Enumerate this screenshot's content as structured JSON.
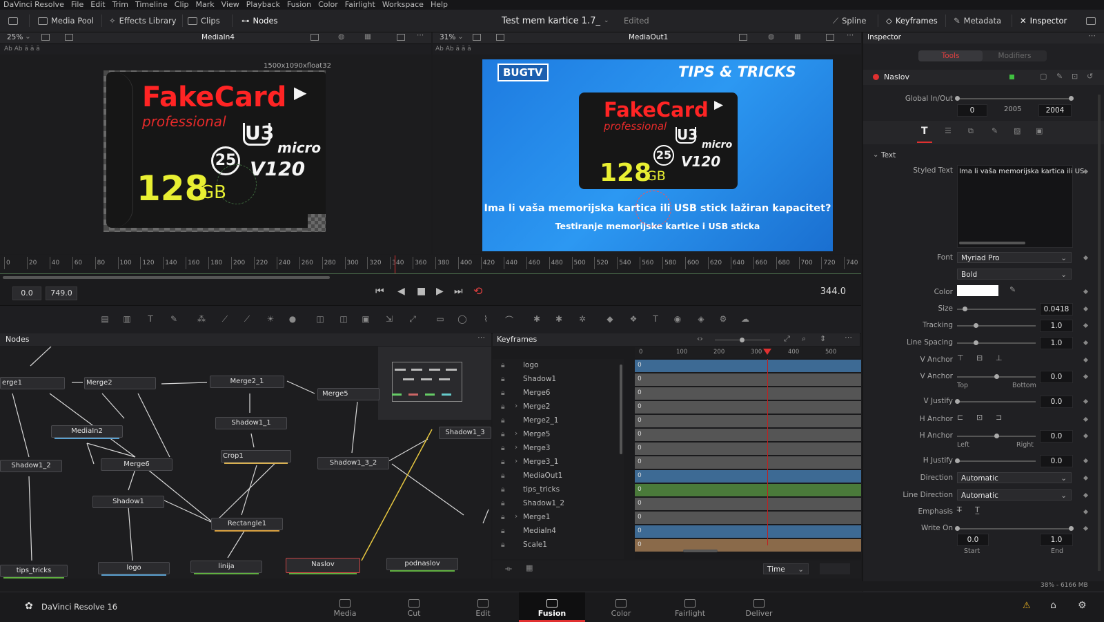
{
  "menu": [
    "DaVinci Resolve",
    "File",
    "Edit",
    "Trim",
    "Timeline",
    "Clip",
    "Mark",
    "View",
    "Playback",
    "Fusion",
    "Color",
    "Fairlight",
    "Workspace",
    "Help"
  ],
  "toolbar": {
    "media_pool": "Media Pool",
    "effects_library": "Effects Library",
    "clips": "Clips",
    "nodes": "Nodes",
    "project_title": "Test mem kartice 1.7_",
    "edited": "Edited",
    "spline": "Spline",
    "keyframes": "Keyframes",
    "metadata": "Metadata",
    "inspector": "Inspector"
  },
  "viewer_left": {
    "zoom": "25%",
    "name": "MediaIn4",
    "resolution": "1500x1090xfloat32"
  },
  "viewer_right": {
    "zoom": "31%",
    "name": "MediaOut1"
  },
  "card": {
    "brand": "FakeCard",
    "sub": "professional",
    "capacity": "128",
    "unit": "GB",
    "speed_class": "25",
    "uhs": "U3",
    "micro": "micro",
    "video": "V120"
  },
  "thumbnail": {
    "logo": "BUGTV",
    "header": "TIPS & TRICKS",
    "line1": "Ima li vaša memorijska kartica ili USB stick lažiran kapacitet?",
    "line2": "Testiranje memorijske kartice i USB sticka"
  },
  "ruler_ticks": [
    "0",
    "20",
    "40",
    "60",
    "80",
    "100",
    "120",
    "140",
    "160",
    "180",
    "200",
    "220",
    "240",
    "260",
    "280",
    "300",
    "320",
    "340",
    "360",
    "380",
    "400",
    "420",
    "440",
    "460",
    "480",
    "500",
    "520",
    "540",
    "560",
    "580",
    "600",
    "620",
    "640",
    "660",
    "680",
    "700",
    "720",
    "740"
  ],
  "transport": {
    "start": "0.0",
    "end": "749.0",
    "current": "344.0"
  },
  "nodes_panel": {
    "title": "Nodes"
  },
  "nodes": [
    {
      "label": "erge1"
    },
    {
      "label": "Merge2"
    },
    {
      "label": "Merge2_1"
    },
    {
      "label": "Merge5"
    },
    {
      "label": "MediaIn2"
    },
    {
      "label": "Shadow1_1"
    },
    {
      "label": "Shadow1_3"
    },
    {
      "label": "Shadow1_2"
    },
    {
      "label": "Merge6"
    },
    {
      "label": "Crop1"
    },
    {
      "label": "Shadow1_3_2"
    },
    {
      "label": "Shadow1"
    },
    {
      "label": "Rectangle1"
    },
    {
      "label": "tips_tricks"
    },
    {
      "label": "logo"
    },
    {
      "label": "linija"
    },
    {
      "label": "Naslov"
    },
    {
      "label": "podnaslov"
    }
  ],
  "keyframes_panel": {
    "title": "Keyframes",
    "scale": [
      "0",
      "100",
      "200",
      "300",
      "400",
      "500"
    ],
    "mode": "Time"
  },
  "kf_items": [
    "logo",
    "Shadow1",
    "Merge6",
    "Merge2",
    "Merge2_1",
    "Merge5",
    "Merge3",
    "Merge3_1",
    "MediaOut1",
    "tips_tricks",
    "Shadow1_2",
    "Merge1",
    "MediaIn4",
    "Scale1"
  ],
  "kf_values": [
    "0",
    "0",
    "0",
    "0",
    "0",
    "0",
    "0",
    "0",
    "0",
    "0",
    "0",
    "0",
    "0",
    "0"
  ],
  "inspector": {
    "title": "Inspector",
    "tab_tools": "Tools",
    "tab_modifiers": "Modifiers",
    "tool_name": "Naslov",
    "global_label": "Global In/Out",
    "global_in": "0",
    "global_mid": "2005",
    "global_out": "2004",
    "section": "Text",
    "styled_label": "Styled Text",
    "styled_value": "Ima li vaša memorijska kartica ili US",
    "font_label": "Font",
    "font": "Myriad Pro",
    "style": "Bold",
    "color_label": "Color",
    "size_label": "Size",
    "size": "0.0418",
    "tracking_label": "Tracking",
    "tracking": "1.0",
    "spacing_label": "Line Spacing",
    "spacing": "1.0",
    "vanchor_label": "V Anchor",
    "vanchor2_label": "V Anchor",
    "vanchor2": "0.0",
    "top": "Top",
    "bottom": "Bottom",
    "vjustify_label": "V Justify",
    "vjustify": "0.0",
    "hanchor_label": "H Anchor",
    "hanchor2_label": "H Anchor",
    "hanchor2": "0.0",
    "left": "Left",
    "right": "Right",
    "hjustify_label": "H Justify",
    "hjustify": "0.0",
    "direction_label": "Direction",
    "direction": "Automatic",
    "linedir_label": "Line Direction",
    "linedir": "Automatic",
    "emphasis_label": "Emphasis",
    "writeon_label": "Write On",
    "writeon_start": "0.0",
    "writeon_end": "1.0",
    "start": "Start",
    "end": "End"
  },
  "status": {
    "memory": "38% - 6166 MB"
  },
  "app_name": "DaVinci Resolve 16",
  "pages": [
    "Media",
    "Cut",
    "Edit",
    "Fusion",
    "Color",
    "Fairlight",
    "Deliver"
  ],
  "active_page": "Fusion"
}
